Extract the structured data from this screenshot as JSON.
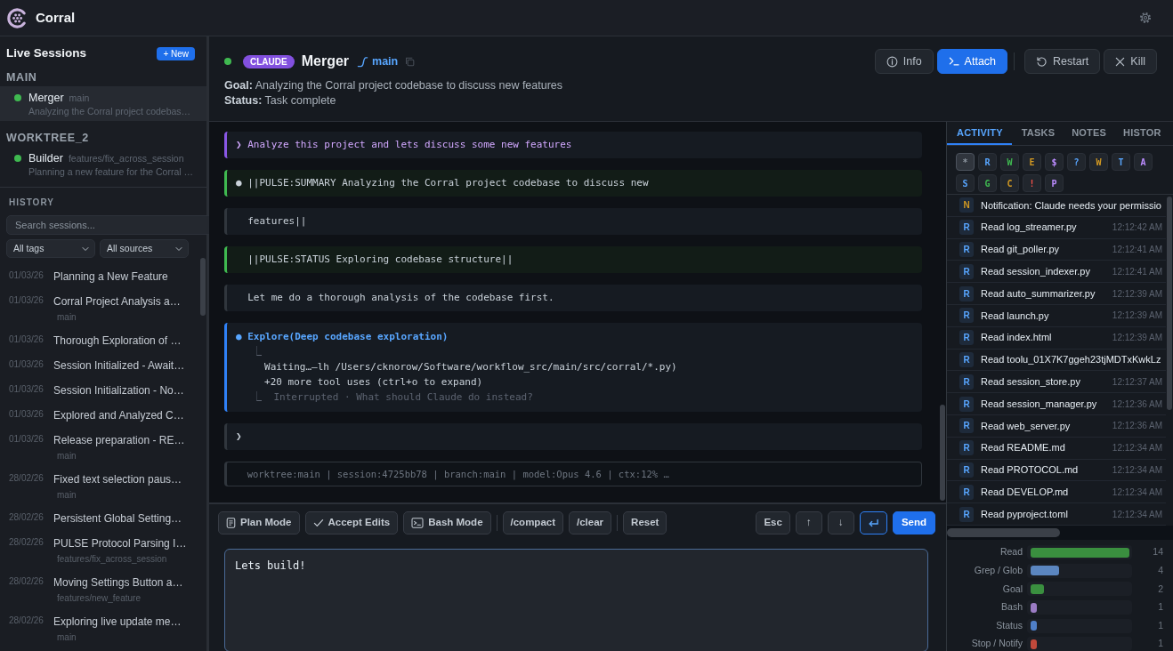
{
  "app": {
    "title": "Corral"
  },
  "sidebar": {
    "live_title": "Live Sessions",
    "new_button": "+ New",
    "groups": [
      {
        "name": "MAIN",
        "sessions": [
          {
            "name": "Merger",
            "branch": "main",
            "summary": "Analyzing the Corral project codebas…",
            "selected": true,
            "color": "#3fb950"
          }
        ]
      },
      {
        "name": "WORKTREE_2",
        "sessions": [
          {
            "name": "Builder",
            "branch": "features/fix_across_session",
            "summary": "Planning a new feature for the Corral …",
            "selected": false,
            "color": "#3fb950"
          }
        ]
      }
    ],
    "history": {
      "title": "HISTORY",
      "search": {
        "placeholder": "Search sessions..."
      },
      "filters": [
        "All tags",
        "All sources"
      ],
      "items": [
        {
          "date": "01/03/26",
          "title": "Planning a New Feature"
        },
        {
          "date": "01/03/26",
          "title": "Corral Project Analysis a…",
          "branch": "main"
        },
        {
          "date": "01/03/26",
          "title": "Thorough Exploration of …"
        },
        {
          "date": "01/03/26",
          "title": "Session Initialized - Await…"
        },
        {
          "date": "01/03/26",
          "title": "Session Initialization - No…"
        },
        {
          "date": "01/03/26",
          "title": "Explored and Analyzed C…"
        },
        {
          "date": "01/03/26",
          "title": "Release preparation - RE…",
          "branch": "main"
        },
        {
          "date": "28/02/26",
          "title": "Fixed text selection paus…",
          "branch": "main"
        },
        {
          "date": "28/02/26",
          "title": "Persistent Global Setting…"
        },
        {
          "date": "28/02/26",
          "title": "PULSE Protocol Parsing I…",
          "branch": "features/fix_across_session"
        },
        {
          "date": "28/02/26",
          "title": "Moving Settings Button a…",
          "branch": "features/new_feature"
        },
        {
          "date": "28/02/26",
          "title": "Exploring live update me…",
          "branch": "main"
        }
      ]
    }
  },
  "session": {
    "color": "#3fb950",
    "agent": "CLAUDE",
    "name": "Merger",
    "branch": "main",
    "goal": "**Goal:** Analyzing the Corral project codebase to discuss new features",
    "status": "**Status:** Task complete",
    "actions": [
      {
        "kind": "info",
        "label": "Info"
      },
      {
        "kind": "attach",
        "label": "Attach"
      },
      {
        "kind": "separator"
      },
      {
        "kind": "restart",
        "label": "Restart"
      },
      {
        "kind": "kill",
        "label": "Kill"
      }
    ]
  },
  "console": {
    "blocks": [
      {
        "kind": "prompt",
        "marker": "❯",
        "text": "Analyze this project and lets discuss some new features"
      },
      {
        "kind": "pulse",
        "marker": "●",
        "text": "||PULSE:SUMMARY Analyzing the Corral project codebase to discuss new"
      },
      {
        "kind": "output",
        "text": "features||"
      },
      {
        "kind": "pulse",
        "text": "||PULSE:STATUS Exploring codebase structure||"
      },
      {
        "kind": "output",
        "text": "Let me do a thorough analysis of the codebase first."
      },
      {
        "kind": "tool",
        "marker": "●",
        "text": "Explore(Deep codebase exploration)",
        "lines": [
          {
            "kind": "connector",
            "text": "⎿"
          },
          {
            "kind": "detail",
            "text": "Waiting…—lh /Users/cknorow/Software/workflow_src/main/src/corral/*.py)"
          },
          {
            "kind": "detail",
            "text": "+20 more tool uses (ctrl+o to expand)"
          },
          {
            "kind": "muted",
            "text": "⎿  Interrupted · What should Claude do instead?"
          }
        ]
      },
      {
        "kind": "input",
        "marker": "❯"
      },
      {
        "kind": "statusline",
        "text": "worktree:main | session:4725bb78 | branch:main | model:Opus 4.6 | ctx:12% …"
      }
    ]
  },
  "composer": {
    "modes": [
      {
        "kind": "plan",
        "label": "Plan Mode"
      },
      {
        "kind": "accept",
        "label": "Accept Edits"
      },
      {
        "kind": "bash",
        "label": "Bash Mode"
      },
      {
        "kind": "separator"
      },
      {
        "kind": "plain",
        "label": "/compact"
      },
      {
        "kind": "plain",
        "label": "/clear"
      },
      {
        "kind": "separator"
      },
      {
        "kind": "plain",
        "label": "Reset"
      }
    ],
    "keys": [
      "Esc",
      "↑",
      "↓"
    ],
    "newline_toggle": {
      "on": true
    },
    "send": "Send",
    "value": "Lets build!"
  },
  "panel": {
    "tabs": [
      {
        "label": "ACTIVITY",
        "selected": true
      },
      {
        "label": "TASKS",
        "selected": false
      },
      {
        "label": "NOTES",
        "selected": false
      },
      {
        "label": "HISTOR",
        "selected": false
      }
    ],
    "filters": [
      {
        "label": "*",
        "color": "#8b949e",
        "selected": true
      },
      {
        "label": "R",
        "color": "#58a6ff",
        "selected": false
      },
      {
        "label": "W",
        "color": "#3fb950",
        "selected": false
      },
      {
        "label": "E",
        "color": "#d29922",
        "selected": false
      },
      {
        "label": "$",
        "color": "#bc8cff",
        "selected": false
      },
      {
        "label": "?",
        "color": "#58a6ff",
        "selected": false
      },
      {
        "label": "W",
        "color": "#d29922",
        "selected": false
      },
      {
        "label": "T",
        "color": "#58a6ff",
        "selected": false
      },
      {
        "label": "A",
        "color": "#bc8cff",
        "selected": false
      },
      {
        "label": "S",
        "color": "#58a6ff",
        "selected": false
      },
      {
        "label": "G",
        "color": "#3fb950",
        "selected": false
      },
      {
        "label": "C",
        "color": "#d29922",
        "selected": false
      },
      {
        "label": "!",
        "color": "#f85149",
        "selected": false
      },
      {
        "label": "P",
        "color": "#bc8cff",
        "selected": false
      }
    ],
    "activity": [
      {
        "tag": "N",
        "color": "#d29922",
        "text": "Notification: Claude needs your permissio"
      },
      {
        "tag": "R",
        "color": "#58a6ff",
        "text": "Read log_streamer.py",
        "time": "12:12:42 AM"
      },
      {
        "tag": "R",
        "color": "#58a6ff",
        "text": "Read git_poller.py",
        "time": "12:12:41 AM"
      },
      {
        "tag": "R",
        "color": "#58a6ff",
        "text": "Read session_indexer.py",
        "time": "12:12:41 AM"
      },
      {
        "tag": "R",
        "color": "#58a6ff",
        "text": "Read auto_summarizer.py",
        "time": "12:12:39 AM"
      },
      {
        "tag": "R",
        "color": "#58a6ff",
        "text": "Read launch.py",
        "time": "12:12:39 AM"
      },
      {
        "tag": "R",
        "color": "#58a6ff",
        "text": "Read index.html",
        "time": "12:12:39 AM"
      },
      {
        "tag": "R",
        "color": "#58a6ff",
        "text": "Read toolu_01X7K7ggeh23tjMDTxKwkLz"
      },
      {
        "tag": "R",
        "color": "#58a6ff",
        "text": "Read session_store.py",
        "time": "12:12:37 AM"
      },
      {
        "tag": "R",
        "color": "#58a6ff",
        "text": "Read session_manager.py",
        "time": "12:12:36 AM"
      },
      {
        "tag": "R",
        "color": "#58a6ff",
        "text": "Read web_server.py",
        "time": "12:12:36 AM"
      },
      {
        "tag": "R",
        "color": "#58a6ff",
        "text": "Read README.md",
        "time": "12:12:34 AM"
      },
      {
        "tag": "R",
        "color": "#58a6ff",
        "text": "Read PROTOCOL.md",
        "time": "12:12:34 AM"
      },
      {
        "tag": "R",
        "color": "#58a6ff",
        "text": "Read DEVELOP.md",
        "time": "12:12:34 AM"
      },
      {
        "tag": "R",
        "color": "#58a6ff",
        "text": "Read pyproject.toml",
        "time": "12:12:34 AM"
      }
    ],
    "tool_counts": [
      {
        "label": "Read",
        "count": "14",
        "level": 1,
        "color": "#3a8f3f"
      },
      {
        "label": "Grep / Glob",
        "count": "4",
        "level": 0.29,
        "color": "#5b86c0"
      },
      {
        "label": "Goal",
        "count": "2",
        "level": 0.14,
        "color": "#3a8f3f"
      },
      {
        "label": "Bash",
        "count": "1",
        "level": 0.07,
        "color": "#9b7cc4"
      },
      {
        "label": "Status",
        "count": "1",
        "level": 0.07,
        "color": "#4f7fc8"
      },
      {
        "label": "Stop / Notify",
        "count": "1",
        "level": 0.07,
        "color": "#c0493b"
      }
    ]
  }
}
